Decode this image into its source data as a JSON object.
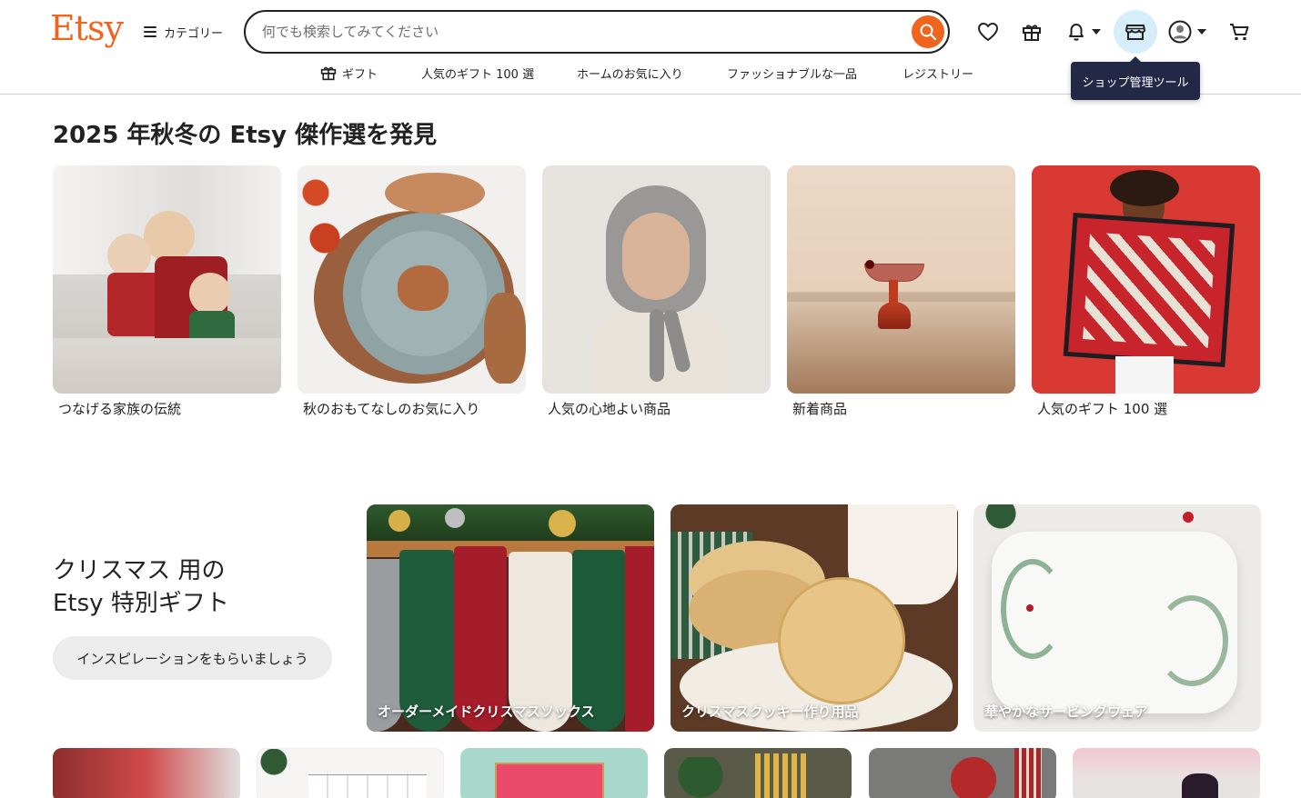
{
  "header": {
    "logo": "Etsy",
    "categories_label": "カテゴリー",
    "search_placeholder": "何でも検索してみてください",
    "tooltip": "ショップ管理ツール"
  },
  "subnav": [
    {
      "label": "ギフト"
    },
    {
      "label": "人気のギフト 100 選"
    },
    {
      "label": "ホームのお気に入り"
    },
    {
      "label": "ファッショナブルな一品"
    },
    {
      "label": "レジストリー"
    }
  ],
  "section1": {
    "title": "2025 年秋冬の Etsy 傑作選を発見",
    "cards": [
      {
        "label": "つなげる家族の伝統"
      },
      {
        "label": "秋のおもてなしのお気に入り"
      },
      {
        "label": "人気の心地よい商品"
      },
      {
        "label": "新着商品"
      },
      {
        "label": "人気のギフト 100 選"
      }
    ]
  },
  "section2": {
    "title_line1": "クリスマス 用の",
    "title_line2": "Etsy 特別ギフト",
    "button": "インスピレーションをもらいましょう",
    "cards": [
      {
        "label": "オーダーメイドクリスマスソックス"
      },
      {
        "label": "クリスマスクッキー作り用品"
      },
      {
        "label": "華やかなサービングウェア"
      }
    ]
  },
  "colors": {
    "brand": "#f1641e",
    "tooltip_bg": "#222845",
    "active_icon_bg": "#d6eefa"
  }
}
